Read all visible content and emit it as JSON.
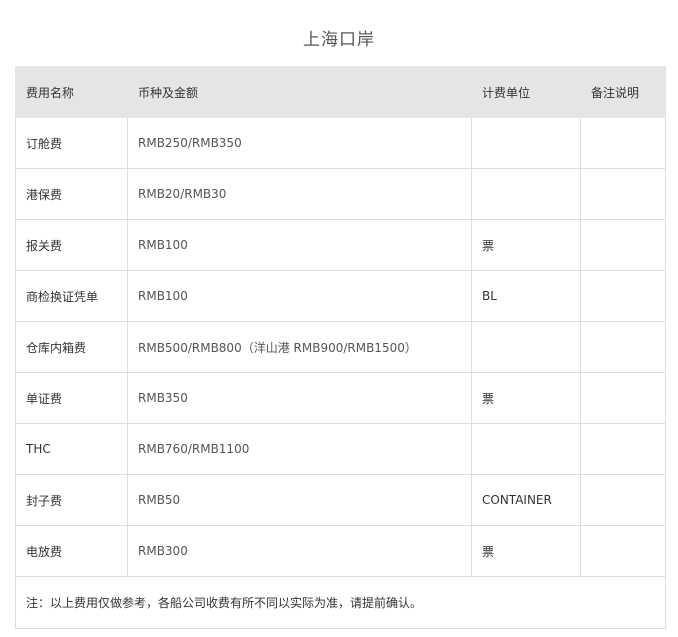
{
  "page": {
    "title": "上海口岸"
  },
  "table": {
    "headers": [
      "费用名称",
      "币种及金额",
      "计费单位",
      "备注说明"
    ],
    "rows": [
      {
        "name": "订舱费",
        "amount": "RMB250/RMB350",
        "unit": "",
        "remark": ""
      },
      {
        "name": "港保费",
        "amount": "RMB20/RMB30",
        "unit": "",
        "remark": ""
      },
      {
        "name": "报关费",
        "amount": "RMB100",
        "unit": "票",
        "remark": ""
      },
      {
        "name": "商检换证凭单",
        "amount": "RMB100",
        "unit": "BL",
        "remark": ""
      },
      {
        "name": "仓库内箱费",
        "amount": "RMB500/RMB800（洋山港 RMB900/RMB1500）",
        "unit": "",
        "remark": ""
      },
      {
        "name": "单证费",
        "amount": "RMB350",
        "unit": "票",
        "remark": ""
      },
      {
        "name": "THC",
        "amount": "RMB760/RMB1100",
        "unit": "",
        "remark": ""
      },
      {
        "name": "封子费",
        "amount": "RMB50",
        "unit": "CONTAINER",
        "remark": ""
      },
      {
        "name": "电放费",
        "amount": "RMB300",
        "unit": "票",
        "remark": ""
      }
    ],
    "footnote": "注：以上费用仅做参考，各船公司收费有所不同以实际为准，请提前确认。"
  }
}
